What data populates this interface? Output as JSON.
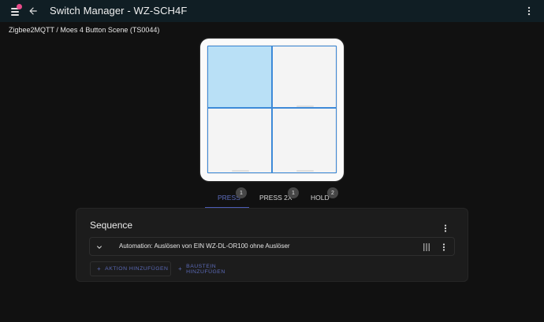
{
  "app": {
    "title": "Switch Manager - WZ-SCH4F"
  },
  "breadcrumb": "Zigbee2MQTT / Moes 4 Button Scene (TS0044)",
  "switch": {
    "buttons": [
      {
        "id": "button-1",
        "selected": true
      },
      {
        "id": "button-2",
        "selected": false
      },
      {
        "id": "button-3",
        "selected": false
      },
      {
        "id": "button-4",
        "selected": false
      }
    ]
  },
  "tabs": [
    {
      "label": "PRESS",
      "badge": "1",
      "active": true
    },
    {
      "label": "PRESS 2X",
      "badge": "1",
      "active": false
    },
    {
      "label": "HOLD",
      "badge": "2",
      "active": false
    }
  ],
  "sequence": {
    "title": "Sequence",
    "items": [
      {
        "label": "Automation: Auslösen von EIN WZ-DL-OR100 ohne Auslöser"
      }
    ],
    "add_action_label": "AKTION HINZUFÜGEN",
    "add_block_label": "BAUSTEIN HINZUFÜGEN"
  },
  "colors": {
    "accent": "#4c5cb6",
    "selected_button": "#b9e0f6",
    "notification_dot": "#e84b8a",
    "topbar": "#101e24"
  },
  "icons": [
    "menu-icon",
    "back-arrow-icon",
    "more-vert-icon",
    "chevron-down-icon",
    "drag-handle-icon"
  ]
}
